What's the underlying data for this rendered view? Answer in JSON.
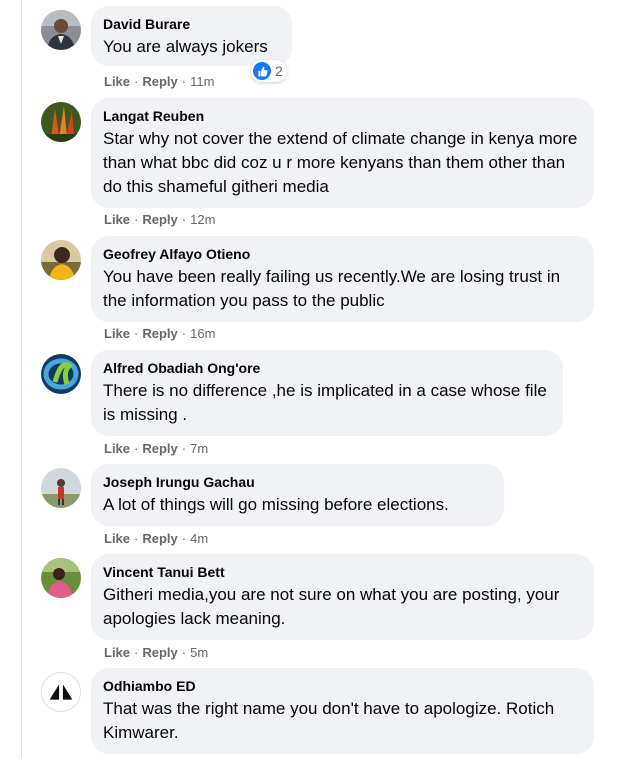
{
  "comments": [
    {
      "author": "David Burare",
      "text": "You are always jokers",
      "like": "Like",
      "reply": "Reply",
      "time": "11m",
      "reaction_count": "2"
    },
    {
      "author": "Langat Reuben",
      "text": "Star why not cover the extend of climate change in kenya more than what bbc did coz u r more kenyans than them other than do this shameful githeri media",
      "like": "Like",
      "reply": "Reply",
      "time": "12m"
    },
    {
      "author": "Geofrey Alfayo Otieno",
      "text": "You have been really failing us recently.We are losing trust in the information you pass to the public",
      "like": "Like",
      "reply": "Reply",
      "time": "16m"
    },
    {
      "author": "Alfred Obadiah Ong'ore",
      "text": "There is no difference ,he is implicated in a case whose file is missing .",
      "like": "Like",
      "reply": "Reply",
      "time": "7m"
    },
    {
      "author": "Joseph Irungu Gachau",
      "text": "A lot of things will go missing before elections.",
      "like": "Like",
      "reply": "Reply",
      "time": "4m"
    },
    {
      "author": "Vincent Tanui Bett",
      "text": "Githeri media,you are not sure on what you are posting, your apologies lack meaning.",
      "like": "Like",
      "reply": "Reply",
      "time": "5m"
    },
    {
      "author": "Odhiambo ED",
      "text": "That was the right name you don't have to apologize. Rotich Kimwarer."
    }
  ],
  "separator": "·",
  "colors": {
    "bubble": "#f0f2f5",
    "meta_text": "#65676b",
    "like_blue": "#1877f2"
  },
  "icons": {
    "reaction": "like-reaction-icon"
  }
}
